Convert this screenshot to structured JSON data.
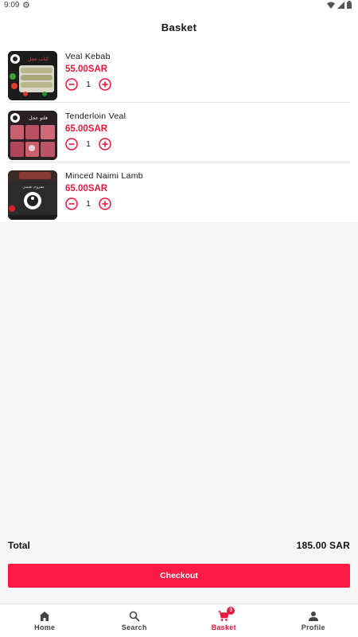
{
  "status_bar": {
    "time": "9:09"
  },
  "header": {
    "title": "Basket"
  },
  "items": [
    {
      "name": "Veal Kebab",
      "price": "55.00SAR",
      "quantity": "1",
      "image_text": "كباب عجل"
    },
    {
      "name": "Tenderloin Veal",
      "price": "65.00SAR",
      "quantity": "1",
      "image_text": "فلتو عجل"
    },
    {
      "name": "Minced Naimi Lamb",
      "price": "65.00SAR",
      "quantity": "1",
      "image_text": "مفروم نعيمي"
    }
  ],
  "summary": {
    "total_label": "Total",
    "total_value": "185.00 SAR"
  },
  "checkout_label": "Checkout",
  "nav": [
    {
      "label": "Home",
      "icon": "home-icon"
    },
    {
      "label": "Search",
      "icon": "search-icon"
    },
    {
      "label": "Basket",
      "icon": "cart-icon",
      "badge": "3",
      "active": true
    },
    {
      "label": "Profile",
      "icon": "person-icon"
    }
  ],
  "colors": {
    "accent": "#e8173b",
    "button": "#fb1b44",
    "background": "#f6f6f6"
  }
}
